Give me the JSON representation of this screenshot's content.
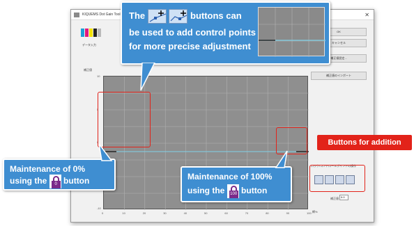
{
  "window": {
    "title": "KIQUEMS Dot Gain Tool - 81",
    "swatch_caption": "データ入力",
    "buttons": {
      "ok": "OK",
      "cancel": "キャンセル",
      "graph_settings": "補正値設定...",
      "import": "補正値のインポート"
    },
    "y_axis_title": "補正値",
    "x_axis_unit": "網%",
    "y_ticks": [
      "10",
      "5",
      "0",
      "-5",
      "-10"
    ],
    "x_ticks": [
      "0",
      "10",
      "20",
      "30",
      "40",
      "50",
      "60",
      "70",
      "80",
      "90",
      "100"
    ],
    "tools_label": "ロック/コントロールポイントの操作",
    "value_label": "補正値",
    "value_input": "0.0"
  },
  "callouts": {
    "top": {
      "prefix": "The",
      "suffix": "buttons can",
      "line2": "be used to add control points",
      "line3": "for more precise adjustment"
    },
    "left": {
      "line1": "Maintenance of 0%",
      "line2_prefix": "using the",
      "line2_suffix": "button",
      "icon_value": "0"
    },
    "right": {
      "line1": "Maintenance of 100%",
      "line2_prefix": "using the",
      "line2_suffix": "button",
      "icon_value": "100"
    },
    "buttons_for_addition": "Buttons for addition"
  },
  "colors": {
    "callout_blue": "#3f8ed1",
    "highlight_red": "#e2231a",
    "lock_purple": "#7b2a8a"
  },
  "icons": [
    "lock-icon",
    "add-point-icon",
    "close-icon"
  ]
}
